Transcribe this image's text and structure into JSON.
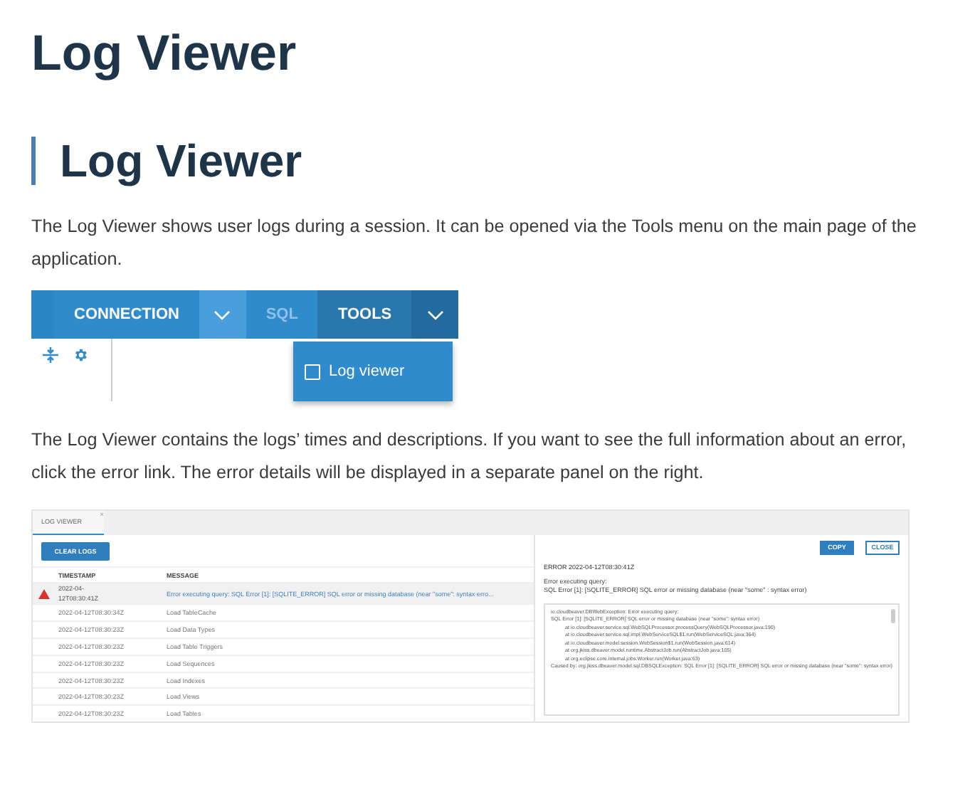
{
  "title": "Log Viewer",
  "section": {
    "heading": "Log Viewer",
    "intro": "The Log Viewer shows user logs during a session. It can be opened via the Tools menu on the main page of the application.",
    "toolbar_screenshot": {
      "items": [
        {
          "kind": "tab",
          "label": "CONNECTION",
          "highlighted": false,
          "open": false,
          "disabled": false
        },
        {
          "kind": "caret",
          "highlighted": true,
          "open": false
        },
        {
          "kind": "tab",
          "label": "SQL",
          "highlighted": false,
          "open": false,
          "disabled": true
        },
        {
          "kind": "tab",
          "label": "TOOLS",
          "highlighted": false,
          "open": true,
          "disabled": false
        },
        {
          "kind": "caret",
          "highlighted": false,
          "open": true
        }
      ],
      "menu": [
        {
          "label": "Log viewer",
          "checked": false
        }
      ]
    },
    "details_text": "The Log Viewer contains the logs’ times and descriptions. If you want to see the full information about an error, click the error link. The error details will be displayed in a separate panel on the right.",
    "log_screenshot": {
      "tab": {
        "label": "LOG VIEWER",
        "close": "×",
        "selected": true
      },
      "clear_button": "CLEAR LOGS",
      "columns": [
        "TIMESTAMP",
        "MESSAGE"
      ],
      "rows": [
        {
          "kind": "error",
          "timestamp": "2022-04-12T08:30:41Z",
          "message": "Error executing query: SQL Error [1]: [SQLITE_ERROR] SQL error or missing database (near \"some\": syntax erro...",
          "selected": true
        },
        {
          "kind": "info",
          "timestamp": "2022-04-12T08:30:34Z",
          "message": "Load TableCache",
          "selected": false
        },
        {
          "kind": "info",
          "timestamp": "2022-04-12T08:30:23Z",
          "message": "Load Data Types",
          "selected": false
        },
        {
          "kind": "info",
          "timestamp": "2022-04-12T08:30:23Z",
          "message": "Load Table Triggers",
          "selected": false
        },
        {
          "kind": "info",
          "timestamp": "2022-04-12T08:30:23Z",
          "message": "Load Sequences",
          "selected": false
        },
        {
          "kind": "info",
          "timestamp": "2022-04-12T08:30:23Z",
          "message": "Load Indexes",
          "selected": false
        },
        {
          "kind": "info",
          "timestamp": "2022-04-12T08:30:23Z",
          "message": "Load Views",
          "selected": false
        },
        {
          "kind": "info",
          "timestamp": "2022-04-12T08:30:23Z",
          "message": "Load Tables",
          "selected": false
        }
      ],
      "details": {
        "buttons": [
          {
            "label": "COPY",
            "kind": "primary"
          },
          {
            "label": "CLOSE",
            "kind": "outline"
          }
        ],
        "title": "ERROR 2022-04-12T08:30:41Z",
        "message": [
          "Error executing query:",
          "SQL Error [1]: [SQLITE_ERROR] SQL error or missing database (near \"some\" : syntax error)"
        ],
        "trace": [
          {
            "kind": "line",
            "text": "io.cloudbeaver.DBWebException: Error executing query:"
          },
          {
            "kind": "line",
            "text": "SQL Error [1]: [SQLITE_ERROR] SQL error or missing database (near \"some\": syntax error)"
          },
          {
            "kind": "frame",
            "text": "at io.cloudbeaver.service.sql.WebSQLProcessor.processQuery(WebSQLProcessor.java:190)"
          },
          {
            "kind": "frame",
            "text": "at io.cloudbeaver.service.sql.impl.WebServiceSQL$1.run(WebServiceSQL.java:364)"
          },
          {
            "kind": "frame",
            "text": "at io.cloudbeaver.model.session.WebSession$1.run(WebSession.java:614)"
          },
          {
            "kind": "frame",
            "text": "at org.jkiss.dbeaver.model.runtime.AbstractJob.run(AbstractJob.java:105)"
          },
          {
            "kind": "frame",
            "text": "at org.eclipse.core.internal.jobs.Worker.run(Worker.java:63)"
          },
          {
            "kind": "line",
            "text": "Caused by: org.jkiss.dbeaver.model.sql.DBSQLException: SQL Error [1]: [SQLITE_ERROR] SQL error or missing database (near \"some\": syntax error)"
          }
        ]
      }
    }
  }
}
